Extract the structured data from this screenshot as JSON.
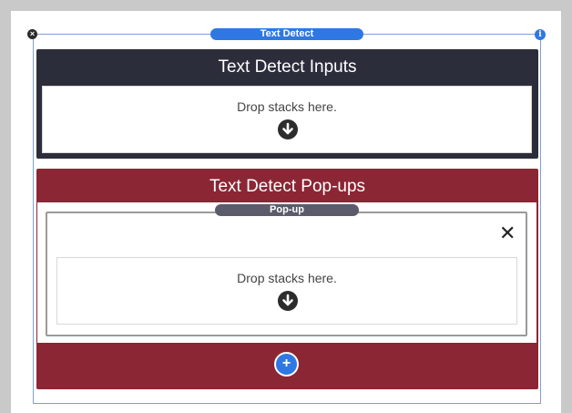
{
  "frame": {
    "label": "Text Detect",
    "close_glyph": "×",
    "info_glyph": "i"
  },
  "inputs_section": {
    "title": "Text Detect Inputs",
    "drop_text": "Drop stacks here.",
    "arrow_icon": "down-arrow-circle-icon"
  },
  "popups_section": {
    "title": "Text Detect Pop-ups",
    "popup": {
      "label": "Pop-up",
      "close_glyph": "✕",
      "drop_text": "Drop stacks here.",
      "arrow_icon": "down-arrow-circle-icon"
    },
    "add_glyph": "+"
  },
  "colors": {
    "inputs_bg": "#2b2d3b",
    "popups_bg": "#8b2634",
    "accent": "#2f78e4"
  }
}
